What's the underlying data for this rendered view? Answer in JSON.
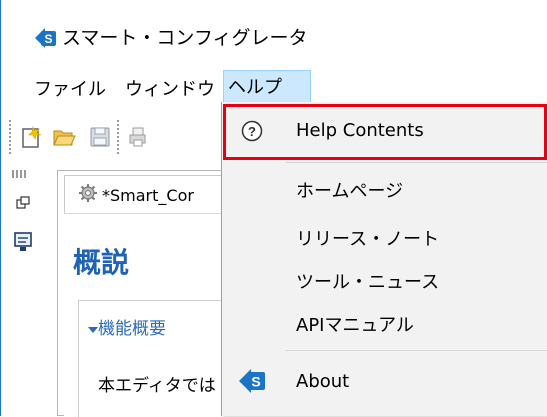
{
  "window": {
    "title": "スマート・コンフィグレータ",
    "accent_color": "#1c74c7"
  },
  "menu": {
    "items": [
      {
        "label": "ファイル"
      },
      {
        "label": "ウィンドウ"
      },
      {
        "label": "ヘルプ"
      }
    ],
    "active": "ヘルプ"
  },
  "toolbar": {
    "icons": [
      "new-file-icon",
      "open-folder-icon",
      "save-icon",
      "print-icon"
    ]
  },
  "editor": {
    "tab_label": "*Smart_Cor",
    "page_title": "概説",
    "section": {
      "title": "機能概要",
      "body_text": "本エディタでは"
    }
  },
  "help_menu": {
    "items": [
      {
        "label": "Help Contents",
        "icon": "help-circle-icon",
        "highlighted": true
      },
      {
        "label": "ホームページ"
      },
      {
        "label": "リリース・ノート"
      },
      {
        "label": "ツール・ニュース"
      },
      {
        "label": "APIマニュアル"
      },
      {
        "label": "About",
        "icon": "app-logo-icon"
      }
    ],
    "highlight_color": "#e60012"
  }
}
